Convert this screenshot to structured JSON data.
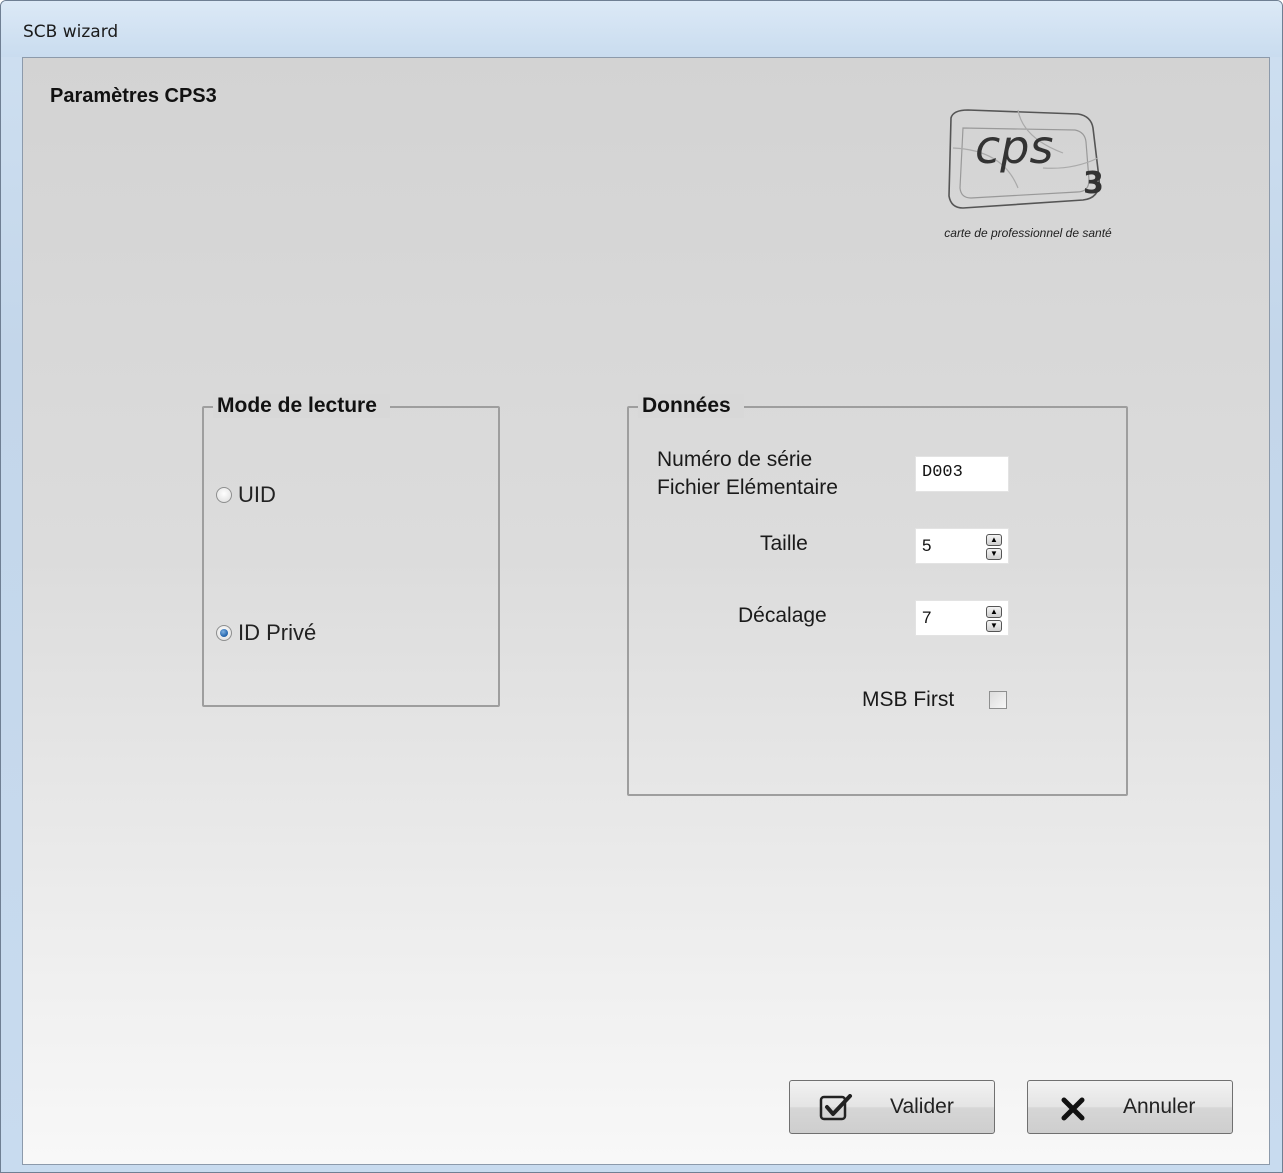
{
  "window": {
    "title": "SCB wizard"
  },
  "page": {
    "title": "Paramètres CPS3"
  },
  "logo": {
    "text": "cps",
    "subscript": "3",
    "tagline": "carte de professionnel de santé"
  },
  "mode_lecture": {
    "legend": "Mode de lecture",
    "options": [
      {
        "label": "UID",
        "checked": false
      },
      {
        "label": "ID Privé",
        "checked": true
      }
    ]
  },
  "donnees": {
    "legend": "Données",
    "serial_label_line1": "Numéro de série",
    "serial_label_line2": "Fichier Elémentaire",
    "serial_value": "D003",
    "taille_label": "Taille",
    "taille_value": "5",
    "decalage_label": "Décalage",
    "decalage_value": "7",
    "msb_label": "MSB First",
    "msb_checked": false
  },
  "buttons": {
    "valider": "Valider",
    "annuler": "Annuler"
  }
}
